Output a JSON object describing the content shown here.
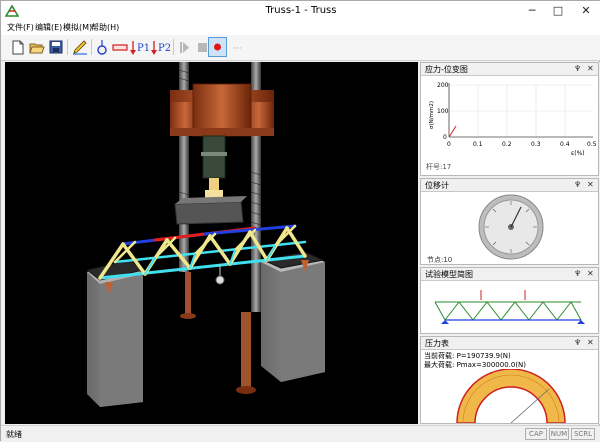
{
  "window": {
    "title": "Truss-1 - Truss",
    "minimize": "─",
    "maximize": "□",
    "close": "✕"
  },
  "menu": [
    "文件(F)",
    "编辑(E)",
    "模拟(M)",
    "帮助(H)"
  ],
  "toolbar": {
    "load_label_1": "P1",
    "load_label_2": "P2"
  },
  "panes": {
    "stress_strain": {
      "title": "应力-位变图",
      "pin": "♆",
      "close": "✕",
      "y_ticks": [
        "200",
        "100",
        "0"
      ],
      "x_ticks": [
        "0",
        "0.1",
        "0.2",
        "0.3",
        "0.4",
        "0.5"
      ],
      "y_label": "σ(N/mm2)",
      "x_label": "ε(%)",
      "member_readout": "杆号:17"
    },
    "dial_gauge": {
      "title": "位移计",
      "pin": "♆",
      "close": "✕",
      "node_readout": "节点:10"
    },
    "model_diagram": {
      "title": "试验模型简图",
      "pin": "♆",
      "close": "✕"
    },
    "pressure_gauge": {
      "title": "压力表",
      "pin": "♆",
      "close": "✕",
      "current_load": "当前荷载: P=190739.9(N)",
      "max_load": "最大荷载: Pmax=300000.0(N)"
    }
  },
  "status": {
    "text": "就绪",
    "indicators": [
      "CAP",
      "NUM",
      "SCRL"
    ]
  },
  "colors": {
    "member_yellow": "#f0e68c",
    "member_cyan": "#40e0f0",
    "member_red": "#e02020",
    "member_blue": "#2040e0",
    "rust": "#a0522d",
    "gauge_yellow": "#f0b848"
  }
}
